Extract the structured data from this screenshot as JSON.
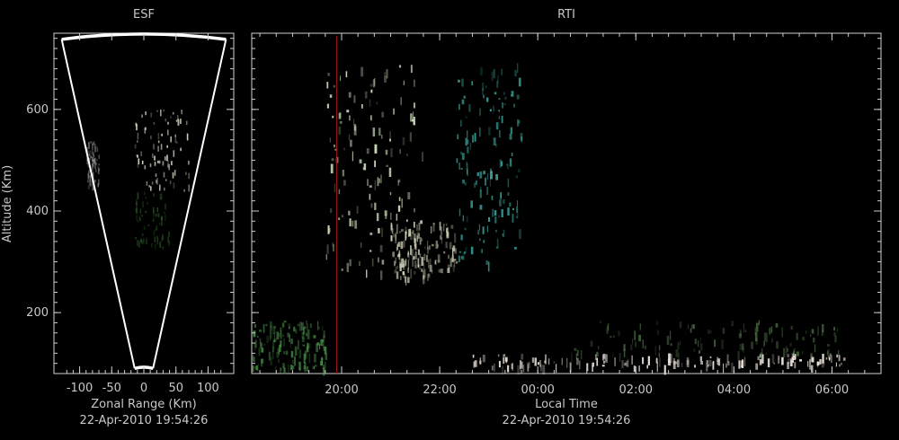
{
  "chart_data": [
    {
      "type": "heatmap",
      "title": "ESF",
      "xlabel": "Zonal Range (Km)",
      "ylabel": "Altitude (Km)",
      "subtitle": "22-Apr-2010 19:54:26",
      "xlim": [
        -140,
        140
      ],
      "ylim": [
        80,
        750
      ],
      "xticks": [
        -100,
        -50,
        0,
        50,
        100
      ],
      "yticks": [
        200,
        400,
        600
      ],
      "fan": {
        "apex_x": 0,
        "inner_altitude": 90,
        "outer_altitude": 745,
        "outer_half_width": 128
      },
      "echo_regions": [
        {
          "x": [
            -90,
            -70
          ],
          "y": [
            450,
            540
          ],
          "intensity": 0.5,
          "color": "#8a8a8a"
        },
        {
          "x": [
            -15,
            70
          ],
          "y": [
            440,
            600
          ],
          "intensity": 0.7,
          "color": "#d8d8c8"
        },
        {
          "x": [
            -15,
            40
          ],
          "y": [
            330,
            440
          ],
          "intensity": 0.4,
          "color": "#2f6a2a"
        }
      ]
    },
    {
      "type": "heatmap",
      "title": "RTI",
      "xlabel": "Local Time",
      "ylabel": "",
      "subtitle": "22-Apr-2010 19:54:26",
      "xlim": [
        "2010-04-22 18:10",
        "2010-04-23 07:00"
      ],
      "ylim": [
        80,
        750
      ],
      "xtick_labels": [
        "20:00",
        "22:00",
        "00:00",
        "02:00",
        "04:00",
        "06:00"
      ],
      "xtick_times": [
        "2010-04-22 20:00",
        "2010-04-22 22:00",
        "2010-04-23 00:00",
        "2010-04-23 02:00",
        "2010-04-23 04:00",
        "2010-04-23 06:00"
      ],
      "yticks": [
        200,
        400,
        600
      ],
      "marker_time": "2010-04-22 19:54",
      "marker_color": "#a01818",
      "echo_regions": [
        {
          "t": [
            "2010-04-22 19:40",
            "2010-04-22 21:40"
          ],
          "y": [
            280,
            690
          ],
          "intensity": 0.75,
          "color": "#cfe0c0"
        },
        {
          "t": [
            "2010-04-22 22:20",
            "2010-04-22 23:40"
          ],
          "y": [
            300,
            700
          ],
          "intensity": 0.7,
          "color": "#3ba7a0"
        },
        {
          "t": [
            "2010-04-22 21:00",
            "2010-04-22 22:20"
          ],
          "y": [
            270,
            380
          ],
          "intensity": 0.6,
          "color": "#e0e0c8"
        },
        {
          "t": [
            "2010-04-22 18:10",
            "2010-04-22 19:40"
          ],
          "y": [
            90,
            185
          ],
          "intensity": 0.6,
          "color": "#4f9a4f"
        },
        {
          "t": [
            "2010-04-23 00:40",
            "2010-04-23 06:10"
          ],
          "y": [
            120,
            185
          ],
          "intensity": 0.45,
          "color": "#5e8a55"
        },
        {
          "t": [
            "2010-04-22 22:40",
            "2010-04-23 06:20"
          ],
          "y": [
            95,
            120
          ],
          "intensity": 0.8,
          "color": "#e8e0d8"
        }
      ]
    }
  ]
}
